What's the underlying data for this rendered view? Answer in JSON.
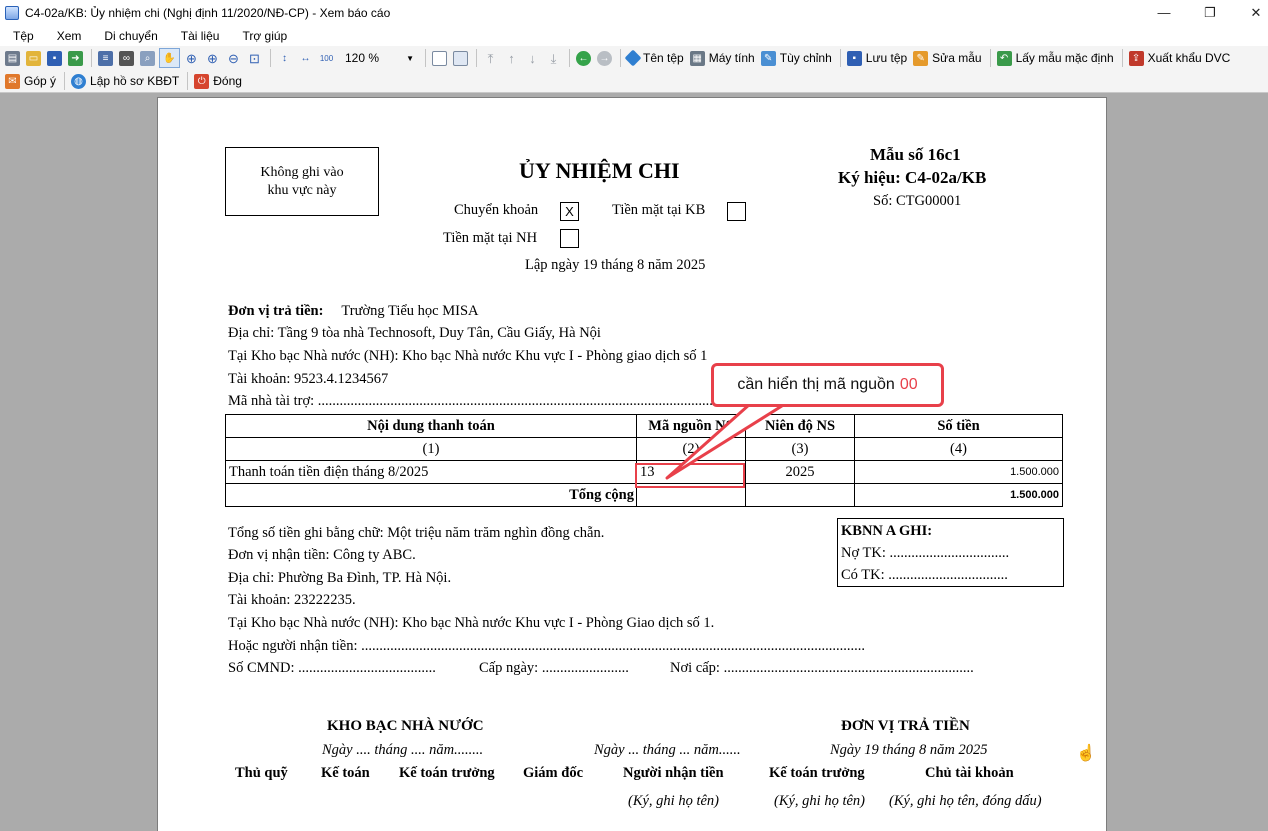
{
  "window": {
    "title": "C4-02a/KB: Ủy nhiệm chi (Nghị định 11/2020/NĐ-CP) - Xem báo cáo",
    "controls": [
      "—",
      "❐",
      "✕"
    ]
  },
  "menu": [
    "Tệp",
    "Xem",
    "Di chuyển",
    "Tài liệu",
    "Trợ giúp"
  ],
  "toolbar": {
    "zoom": "120 %",
    "buttons": {
      "ten_tep": "Tên tệp",
      "may_tinh": "Máy tính",
      "tuy_chinh": "Tùy chỉnh",
      "luu_tep": "Lưu tệp",
      "sua_mau": "Sửa mẫu",
      "lay_mau": "Lấy mẫu mặc định",
      "xuat_khau": "Xuất khẩu DVC"
    },
    "row2": {
      "gop_y": "Góp ý",
      "lap_ho_so": "Lập hồ sơ KBĐT",
      "dong": "Đóng"
    }
  },
  "doc": {
    "nowrite_line1": "Không ghi vào",
    "nowrite_line2": "khu vực này",
    "title": "ỦY NHIỆM CHI",
    "form_no": "Mẫu số 16c1",
    "symbol": "Ký hiệu: C4-02a/KB",
    "number": "Số: CTG00001",
    "opt_transfer": "Chuyển khoản",
    "opt_transfer_mark": "X",
    "opt_cash_kb": "Tiền mặt tại KB",
    "opt_cash_nh": "Tiền mặt tại NH",
    "date_line": "Lập ngày 19 tháng 8 năm 2025",
    "payer_label": "Đơn vị trả tiền:",
    "payer_name": "Trường Tiểu học MISA",
    "payer_address": "Địa chỉ: Tầng 9 tòa nhà Technosoft, Duy Tân, Cầu Giấy, Hà Nội",
    "payer_treasury": "Tại Kho bạc Nhà nước (NH): Kho bạc Nhà nước Khu vực I - Phòng giao dịch số 1",
    "payer_account": "Tài khoản: 9523.4.1234567",
    "sponsor_code": "Mã nhà tài trợ: .....................................................................................................................................................",
    "table": {
      "headers": [
        "Nội dung thanh toán",
        "Mã nguồn NS",
        "Niên độ NS",
        "Số tiền"
      ],
      "indices": [
        "(1)",
        "(2)",
        "(3)",
        "(4)"
      ],
      "row": {
        "content": "Thanh toán tiền điện tháng 8/2025",
        "source": "13",
        "year": "2025",
        "amount": "1.500.000"
      },
      "total_label": "Tổng cộng",
      "total_amount": "1.500.000"
    },
    "amount_words": "Tổng số tiền ghi bằng chữ: Một triệu năm trăm nghìn đồng chẵn.",
    "payee_name": "Đơn vị nhận tiền: Công ty ABC.",
    "payee_address": "Địa chỉ: Phường Ba Đình, TP. Hà Nội.",
    "payee_account": "Tài khoản: 23222235.",
    "payee_treasury": "Tại Kho bạc Nhà nước (NH): Kho bạc Nhà nước Khu vực I - Phòng Giao dịch số 1.",
    "or_receiver": "Hoặc người nhận tiền: ...........................................................................................................................................",
    "id_no": "Số CMND: ......................................",
    "issue_date": "Cấp ngày: ........................",
    "issue_place": "Nơi cấp: .....................................................................",
    "kbnn_title": "KBNN A GHI:",
    "kbnn_debit": "Nợ TK: .................................",
    "kbnn_credit": "Có TK: .................................",
    "sign": {
      "treasury_title": "KHO BẠC NHÀ NƯỚC",
      "treasury_date": "Ngày .... tháng .... năm........",
      "receiver_date": "Ngày ... tháng ... năm......",
      "payer_title": "ĐƠN VỊ TRẢ TIỀN",
      "payer_date": "Ngày 19 tháng 8 năm 2025",
      "roles": [
        "Thủ quỹ",
        "Kế toán",
        "Kế toán trưởng",
        "Giám đốc",
        "Người nhận tiền",
        "Kế toán trưởng",
        "Chủ tài khoản"
      ],
      "note_sign": "(Ký, ghi họ tên)",
      "note_sign2": "(Ký, ghi họ tên)",
      "note_sign_stamp": "(Ký, ghi họ tên, đóng dấu)"
    }
  },
  "annotation": {
    "text": "cần hiển thị mã nguồn",
    "value": "00",
    "color": "#e8404a"
  }
}
